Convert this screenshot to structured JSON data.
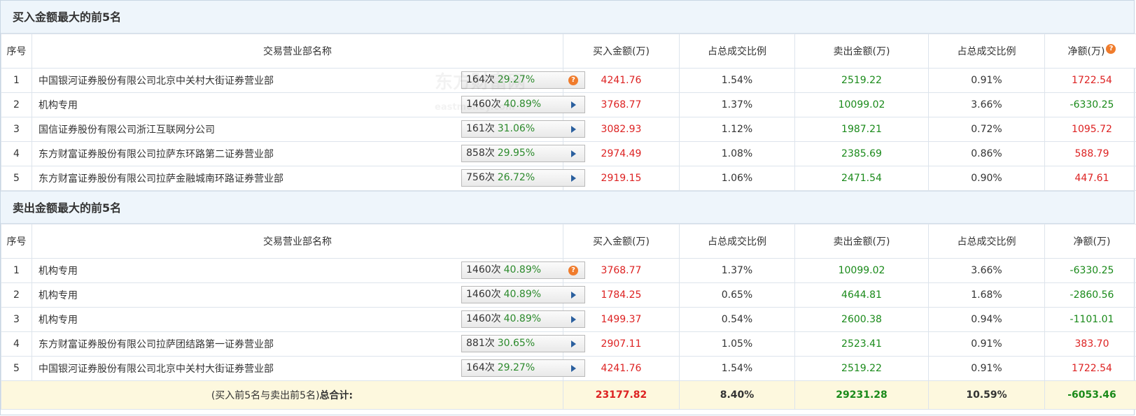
{
  "buy_section": {
    "title": "买入金额最大的前5名",
    "headers": [
      "序号",
      "交易营业部名称",
      "买入金额(万)",
      "占总成交比例",
      "卖出金额(万)",
      "占总成交比例",
      "净额(万)"
    ],
    "rows": [
      {
        "seq": "1",
        "name": "中国银河证券股份有限公司北京中关村大街证券营业部",
        "times": "164次",
        "pct": "29.27%",
        "btn": "help",
        "buy": "4241.76",
        "buy_ratio": "1.54%",
        "sell": "2519.22",
        "sell_ratio": "0.91%",
        "net": "1722.54",
        "net_sign": "pos"
      },
      {
        "seq": "2",
        "name": "机构专用",
        "times": "1460次",
        "pct": "40.89%",
        "btn": "arrow",
        "buy": "3768.77",
        "buy_ratio": "1.37%",
        "sell": "10099.02",
        "sell_ratio": "3.66%",
        "net": "-6330.25",
        "net_sign": "neg"
      },
      {
        "seq": "3",
        "name": "国信证券股份有限公司浙江互联网分公司",
        "times": "161次",
        "pct": "31.06%",
        "btn": "arrow",
        "buy": "3082.93",
        "buy_ratio": "1.12%",
        "sell": "1987.21",
        "sell_ratio": "0.72%",
        "net": "1095.72",
        "net_sign": "pos"
      },
      {
        "seq": "4",
        "name": "东方财富证券股份有限公司拉萨东环路第二证券营业部",
        "times": "858次",
        "pct": "29.95%",
        "btn": "arrow",
        "buy": "2974.49",
        "buy_ratio": "1.08%",
        "sell": "2385.69",
        "sell_ratio": "0.86%",
        "net": "588.79",
        "net_sign": "pos"
      },
      {
        "seq": "5",
        "name": "东方财富证券股份有限公司拉萨金融城南环路证券营业部",
        "times": "756次",
        "pct": "26.72%",
        "btn": "arrow",
        "buy": "2919.15",
        "buy_ratio": "1.06%",
        "sell": "2471.54",
        "sell_ratio": "0.90%",
        "net": "447.61",
        "net_sign": "pos"
      }
    ]
  },
  "sell_section": {
    "title": "卖出金额最大的前5名",
    "headers": [
      "序号",
      "交易营业部名称",
      "买入金额(万)",
      "占总成交比例",
      "卖出金额(万)",
      "占总成交比例",
      "净额(万)"
    ],
    "rows": [
      {
        "seq": "1",
        "name": "机构专用",
        "times": "1460次",
        "pct": "40.89%",
        "btn": "help",
        "buy": "3768.77",
        "buy_ratio": "1.37%",
        "sell": "10099.02",
        "sell_ratio": "3.66%",
        "net": "-6330.25",
        "net_sign": "neg"
      },
      {
        "seq": "2",
        "name": "机构专用",
        "times": "1460次",
        "pct": "40.89%",
        "btn": "arrow",
        "buy": "1784.25",
        "buy_ratio": "0.65%",
        "sell": "4644.81",
        "sell_ratio": "1.68%",
        "net": "-2860.56",
        "net_sign": "neg"
      },
      {
        "seq": "3",
        "name": "机构专用",
        "times": "1460次",
        "pct": "40.89%",
        "btn": "arrow",
        "buy": "1499.37",
        "buy_ratio": "0.54%",
        "sell": "2600.38",
        "sell_ratio": "0.94%",
        "net": "-1101.01",
        "net_sign": "neg"
      },
      {
        "seq": "4",
        "name": "东方财富证券股份有限公司拉萨团结路第一证券营业部",
        "times": "881次",
        "pct": "30.65%",
        "btn": "arrow",
        "buy": "2907.11",
        "buy_ratio": "1.05%",
        "sell": "2523.41",
        "sell_ratio": "0.91%",
        "net": "383.70",
        "net_sign": "pos"
      },
      {
        "seq": "5",
        "name": "中国银河证券股份有限公司北京中关村大街证券营业部",
        "times": "164次",
        "pct": "29.27%",
        "btn": "arrow",
        "buy": "4241.76",
        "buy_ratio": "1.54%",
        "sell": "2519.22",
        "sell_ratio": "0.91%",
        "net": "1722.54",
        "net_sign": "pos"
      }
    ]
  },
  "total": {
    "label_prefix": "(买入前5名与卖出前5名)",
    "label_bold": "总合计:",
    "buy": "23177.82",
    "buy_ratio": "8.40%",
    "sell": "29231.28",
    "sell_ratio": "10.59%",
    "net": "-6053.46"
  },
  "help_glyph": "?",
  "watermark": {
    "cn": "东方财富网",
    "en": "eastmoney.com"
  },
  "colors": {
    "buy": "#dd2222",
    "sell": "#1a8a1a",
    "pct": "#2c8a2c",
    "help": "#f07c2c",
    "total_bg": "#fdf8de",
    "title_bg": "#eef5fb"
  }
}
